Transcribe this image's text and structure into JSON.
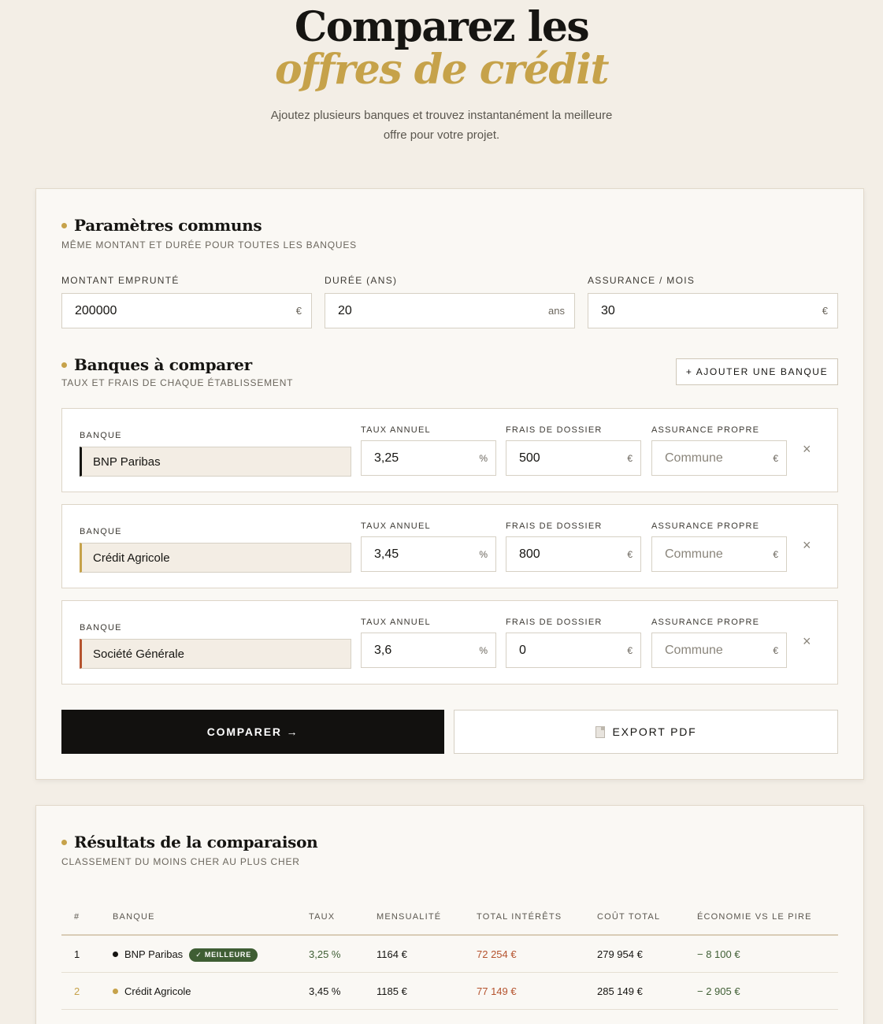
{
  "hero": {
    "title_line1": "Comparez les",
    "title_line2": "offres de crédit",
    "subtitle_line1": "Ajoutez plusieurs banques et trouvez instantanément la meilleure",
    "subtitle_line2": "offre pour votre projet."
  },
  "params": {
    "title": "Paramètres communs",
    "subtitle": "MÊME MONTANT ET DURÉE POUR TOUTES LES BANQUES",
    "fields": [
      {
        "label": "MONTANT EMPRUNTÉ",
        "value": "200000",
        "unit": "€"
      },
      {
        "label": "DURÉE (ANS)",
        "value": "20",
        "unit": "ans"
      },
      {
        "label": "ASSURANCE / MOIS",
        "value": "30",
        "unit": "€"
      }
    ]
  },
  "banks_section": {
    "title": "Banques à comparer",
    "subtitle": "TAUX ET FRAIS DE CHAQUE ÉTABLISSEMENT",
    "add_button": "+ AJOUTER UNE BANQUE",
    "col_bank": "BANQUE",
    "col_rate": "TAUX ANNUEL",
    "col_fees": "FRAIS DE DOSSIER",
    "col_insurance": "ASSURANCE PROPRE",
    "close_glyph": "×",
    "banks": [
      {
        "name": "BNP Paribas",
        "accent": "#161512",
        "rate": "3,25",
        "rate_unit": "%",
        "fees": "500",
        "fees_unit": "€",
        "insurance_placeholder": "Commune",
        "insurance_unit": "€"
      },
      {
        "name": "Crédit Agricole",
        "accent": "#c6a24a",
        "rate": "3,45",
        "rate_unit": "%",
        "fees": "800",
        "fees_unit": "€",
        "insurance_placeholder": "Commune",
        "insurance_unit": "€"
      },
      {
        "name": "Société Générale",
        "accent": "#b5532e",
        "rate": "3,6",
        "rate_unit": "%",
        "fees": "0",
        "fees_unit": "€",
        "insurance_placeholder": "Commune",
        "insurance_unit": "€"
      }
    ]
  },
  "actions": {
    "compare": "COMPARER →",
    "export": "EXPORT PDF"
  },
  "results": {
    "title": "Résultats de la comparaison",
    "subtitle": "CLASSEMENT DU MOINS CHER AU PLUS CHER",
    "headers": [
      "#",
      "BANQUE",
      "TAUX",
      "MENSUALITÉ",
      "TOTAL INTÉRÊTS",
      "COÛT TOTAL",
      "ÉCONOMIE VS LE PIRE"
    ],
    "badge": "✓ MEILLEURE",
    "rows": [
      {
        "rank": "1",
        "bank": "BNP Paribas",
        "dot": "#161512",
        "rate": "3,25 %",
        "monthly": "1164 €",
        "interest": "72 254 €",
        "total": "279 954 €",
        "saving": "− 8 100 €",
        "best": true
      },
      {
        "rank": "2",
        "bank": "Crédit Agricole",
        "dot": "#c6a24a",
        "rate": "3,45 %",
        "monthly": "1185 €",
        "interest": "77 149 €",
        "total": "285 149 €",
        "saving": "− 2 905 €",
        "best": false
      }
    ]
  },
  "colors": {
    "gold": "#c6a24a",
    "green": "#3f5e34",
    "red": "#b5532e",
    "black": "#12110f"
  }
}
